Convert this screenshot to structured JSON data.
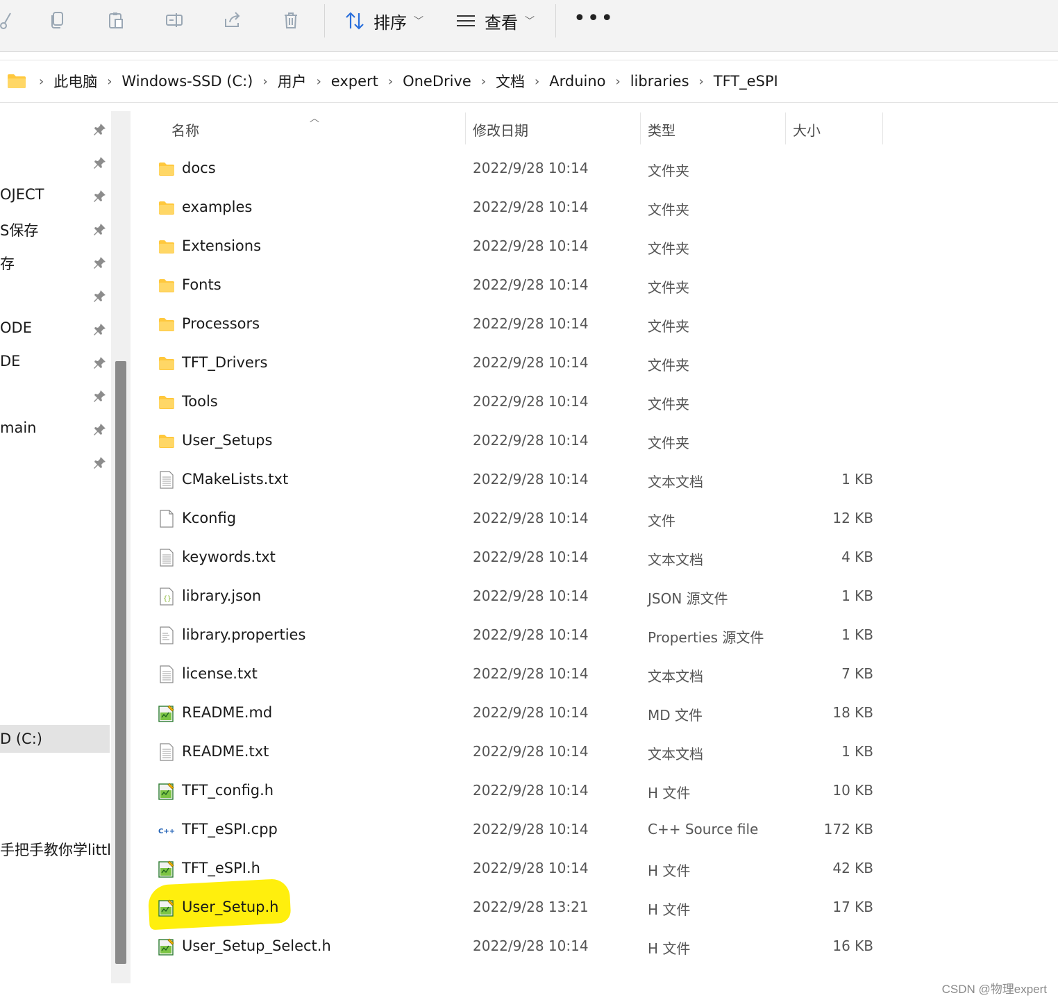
{
  "toolbar": {
    "sort_label": "排序",
    "view_label": "查看",
    "more_label": "•••",
    "icons": [
      "cut-icon",
      "copy-icon",
      "paste-icon",
      "rename-icon",
      "share-icon",
      "delete-icon"
    ]
  },
  "breadcrumb": [
    "此电脑",
    "Windows-SSD (C:)",
    "用户",
    "expert",
    "OneDrive",
    "文档",
    "Arduino",
    "libraries",
    "TFT_eSPI"
  ],
  "nav": {
    "items": [
      {
        "label": ""
      },
      {
        "label": ""
      },
      {
        "label": "OJECT"
      },
      {
        "label": "S保存"
      },
      {
        "label": "存"
      },
      {
        "label": ""
      },
      {
        "label": "ODE"
      },
      {
        "label": "DE"
      },
      {
        "label": ""
      },
      {
        "label": "main"
      },
      {
        "label": ""
      }
    ],
    "drive_label": "D (C:)",
    "bottom_label": "手把手教你学littl"
  },
  "columns": {
    "name": "名称",
    "date": "修改日期",
    "type": "类型",
    "size": "大小"
  },
  "files": [
    {
      "name": "docs",
      "date": "2022/9/28 10:14",
      "type": "文件夹",
      "size": "",
      "icon": "folder"
    },
    {
      "name": "examples",
      "date": "2022/9/28 10:14",
      "type": "文件夹",
      "size": "",
      "icon": "folder"
    },
    {
      "name": "Extensions",
      "date": "2022/9/28 10:14",
      "type": "文件夹",
      "size": "",
      "icon": "folder"
    },
    {
      "name": "Fonts",
      "date": "2022/9/28 10:14",
      "type": "文件夹",
      "size": "",
      "icon": "folder"
    },
    {
      "name": "Processors",
      "date": "2022/9/28 10:14",
      "type": "文件夹",
      "size": "",
      "icon": "folder"
    },
    {
      "name": "TFT_Drivers",
      "date": "2022/9/28 10:14",
      "type": "文件夹",
      "size": "",
      "icon": "folder"
    },
    {
      "name": "Tools",
      "date": "2022/9/28 10:14",
      "type": "文件夹",
      "size": "",
      "icon": "folder"
    },
    {
      "name": "User_Setups",
      "date": "2022/9/28 10:14",
      "type": "文件夹",
      "size": "",
      "icon": "folder"
    },
    {
      "name": "CMakeLists.txt",
      "date": "2022/9/28 10:14",
      "type": "文本文档",
      "size": "1 KB",
      "icon": "text"
    },
    {
      "name": "Kconfig",
      "date": "2022/9/28 10:14",
      "type": "文件",
      "size": "12 KB",
      "icon": "blank"
    },
    {
      "name": "keywords.txt",
      "date": "2022/9/28 10:14",
      "type": "文本文档",
      "size": "4 KB",
      "icon": "text"
    },
    {
      "name": "library.json",
      "date": "2022/9/28 10:14",
      "type": "JSON 源文件",
      "size": "1 KB",
      "icon": "json"
    },
    {
      "name": "library.properties",
      "date": "2022/9/28 10:14",
      "type": "Properties 源文件",
      "size": "1 KB",
      "icon": "props"
    },
    {
      "name": "license.txt",
      "date": "2022/9/28 10:14",
      "type": "文本文档",
      "size": "7 KB",
      "icon": "text"
    },
    {
      "name": "README.md",
      "date": "2022/9/28 10:14",
      "type": "MD 文件",
      "size": "18 KB",
      "icon": "code"
    },
    {
      "name": "README.txt",
      "date": "2022/9/28 10:14",
      "type": "文本文档",
      "size": "1 KB",
      "icon": "text"
    },
    {
      "name": "TFT_config.h",
      "date": "2022/9/28 10:14",
      "type": "H 文件",
      "size": "10 KB",
      "icon": "code"
    },
    {
      "name": "TFT_eSPI.cpp",
      "date": "2022/9/28 10:14",
      "type": "C++ Source file",
      "size": "172 KB",
      "icon": "cpp"
    },
    {
      "name": "TFT_eSPI.h",
      "date": "2022/9/28 10:14",
      "type": "H 文件",
      "size": "42 KB",
      "icon": "code"
    },
    {
      "name": "User_Setup.h",
      "date": "2022/9/28 13:21",
      "type": "H 文件",
      "size": "17 KB",
      "icon": "code"
    },
    {
      "name": "User_Setup_Select.h",
      "date": "2022/9/28 10:14",
      "type": "H 文件",
      "size": "16 KB",
      "icon": "code"
    }
  ],
  "highlight_color": "#ffee00",
  "folder_color": "#ffc83d",
  "watermark": "CSDN @物理expert"
}
